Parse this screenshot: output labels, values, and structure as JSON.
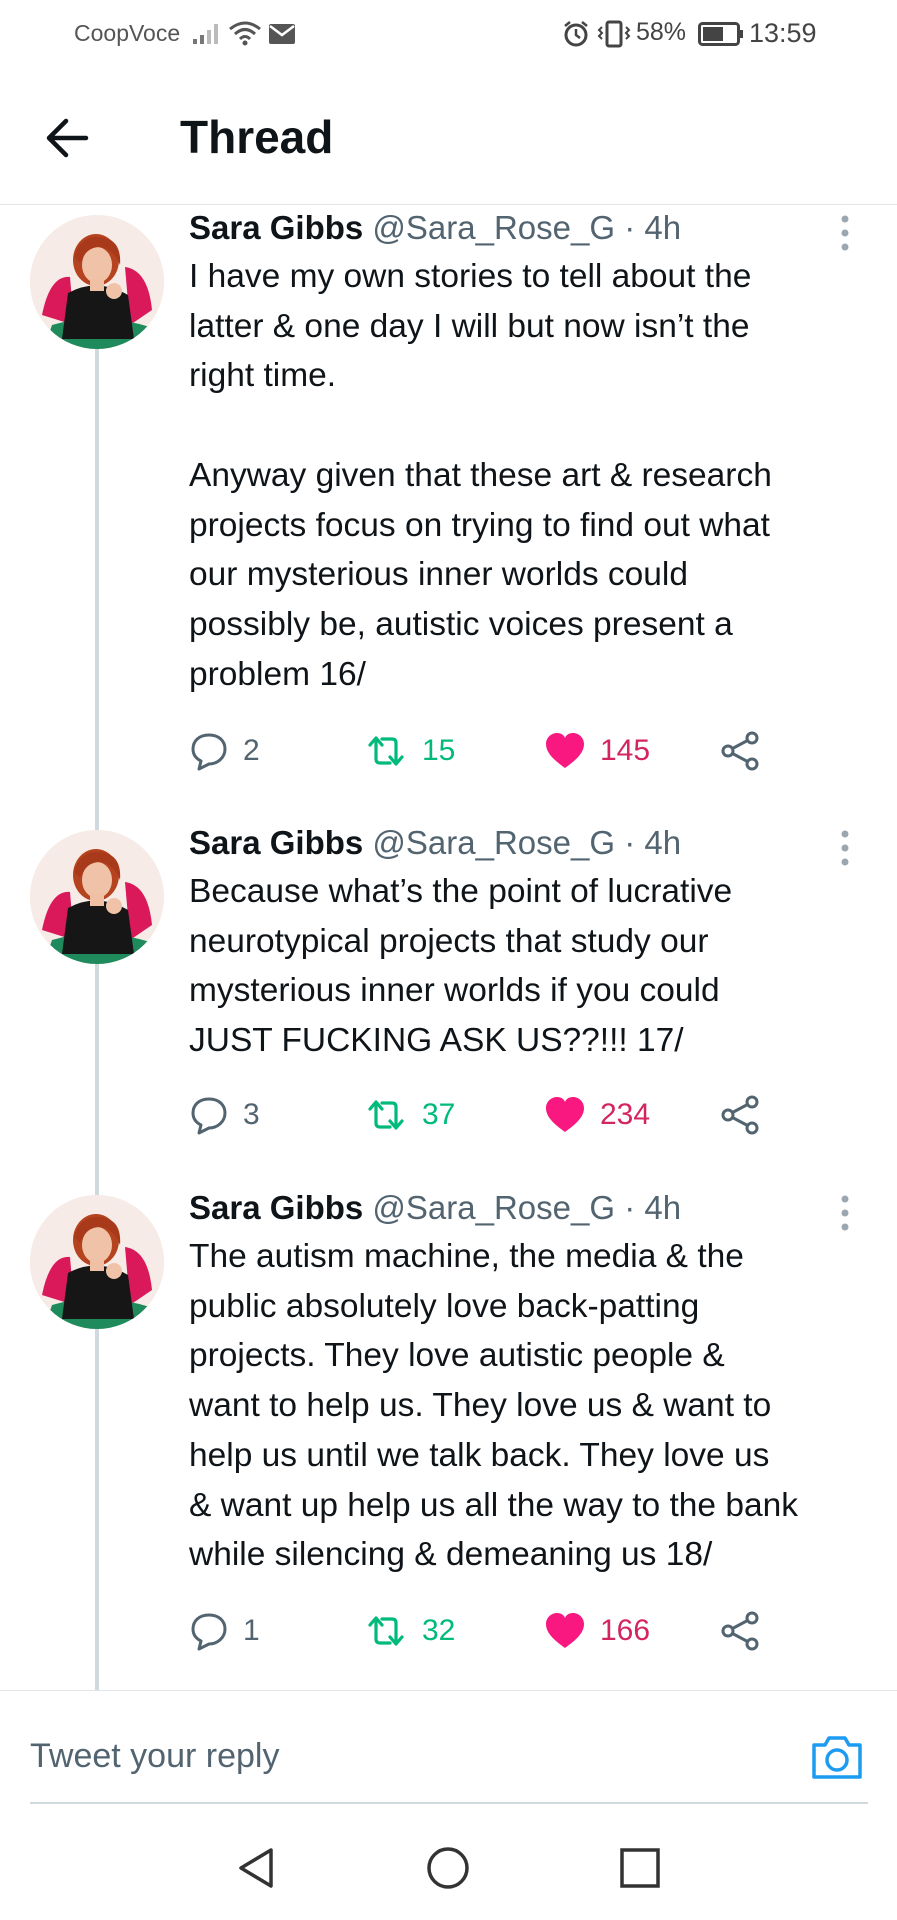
{
  "status_bar": {
    "carrier": "CoopVoce",
    "battery_percent": "58%",
    "time": "13:59",
    "icons": [
      "signal-icon",
      "wifi-icon",
      "mail-icon",
      "alarm-icon",
      "vibrate-icon",
      "battery-icon"
    ]
  },
  "header": {
    "title": "Thread",
    "back_icon": "arrow-left-icon"
  },
  "colors": {
    "text": "#0f1419",
    "muted": "#536471",
    "retweet": "#00ba7c",
    "like": "#f91880",
    "accent": "#1d9bf0",
    "thread_line": "#cfd9de"
  },
  "tweets": [
    {
      "name": "Sara Gibbs",
      "handle": "@Sara_Rose_G",
      "separator": "·",
      "time": "4h",
      "text": "I have my own stories to tell about the\nlatter & one day I will but now isn’t the\nright time.\n\nAnyway given that these art & research\nprojects focus on trying to find out what\nour mysterious inner worlds could\npossibly be, autistic voices present a\nproblem 16/",
      "replies": "2",
      "retweets": "15",
      "likes": "145",
      "liked": true
    },
    {
      "name": "Sara Gibbs",
      "handle": "@Sara_Rose_G",
      "separator": "·",
      "time": "4h",
      "text": "Because what’s the point of lucrative\nneurotypical projects that study our\nmysterious inner worlds if you could\nJUST FUCKING ASK US??!!! 17/",
      "replies": "3",
      "retweets": "37",
      "likes": "234",
      "liked": true
    },
    {
      "name": "Sara Gibbs",
      "handle": "@Sara_Rose_G",
      "separator": "·",
      "time": "4h",
      "text": "The autism machine, the media & the\npublic absolutely love back-patting\nprojects. They love autistic people &\nwant to help us. They love us & want to\nhelp us until we talk back. They love us\n& want up help us all the way to the bank\nwhile silencing & demeaning us 18/",
      "replies": "1",
      "retweets": "32",
      "likes": "166",
      "liked": true
    }
  ],
  "reply_bar": {
    "placeholder": "Tweet your reply",
    "camera_icon": "camera-icon"
  },
  "nav_bar": {
    "buttons": [
      "back-triangle-icon",
      "home-circle-icon",
      "recents-square-icon"
    ]
  }
}
